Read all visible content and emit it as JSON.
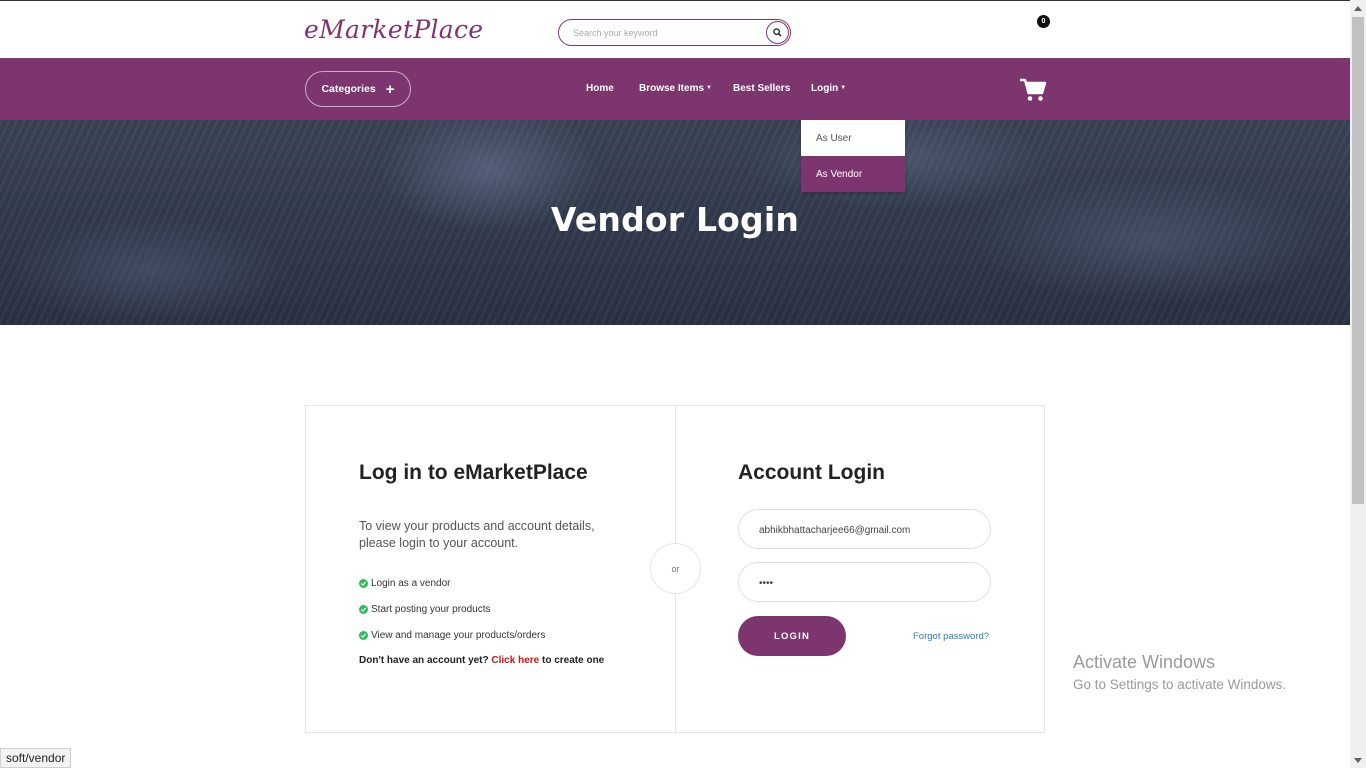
{
  "header": {
    "logo": "eMarketPlace",
    "search_placeholder": "Search your keyword",
    "search_icon": "search-icon"
  },
  "nav": {
    "categories_label": "Categories",
    "categories_icon": "+",
    "items": [
      {
        "label": "Home",
        "dropdown": false
      },
      {
        "label": "Browse Items",
        "dropdown": true
      },
      {
        "label": "Best Sellers",
        "dropdown": false
      },
      {
        "label": "Login",
        "dropdown": true
      }
    ],
    "cart_count": "0",
    "cart_icon": "cart-icon"
  },
  "login_dropdown": {
    "items": [
      "As User",
      "As Vendor"
    ],
    "active": "As Vendor"
  },
  "hero": {
    "title": "Vendor Login"
  },
  "left_panel": {
    "title": "Log in to eMarketPlace",
    "description": "To view your products and account details, please login to your account.",
    "features": [
      "Login as a vendor",
      "Start posting your products",
      "View and manage your products/orders"
    ],
    "signup_prefix": "Don't have an account yet?",
    "signup_link": "Click here",
    "signup_suffix": "to create one"
  },
  "divider_label": "or",
  "right_panel": {
    "title": "Account Login",
    "email_value": "abhikbhattacharjee66@gmail.com",
    "password_value": "••••",
    "login_button": "LOGIN",
    "forgot_link": "Forgot password?"
  },
  "watermark": {
    "title": "Activate Windows",
    "subtitle": "Go to Settings to activate Windows."
  },
  "status_bar": {
    "url": "soft/vendor"
  },
  "colors": {
    "brand": "#7d3570",
    "link_red": "#d01010",
    "link_blue": "#2a7fc0",
    "check_green": "#2ebd59"
  }
}
